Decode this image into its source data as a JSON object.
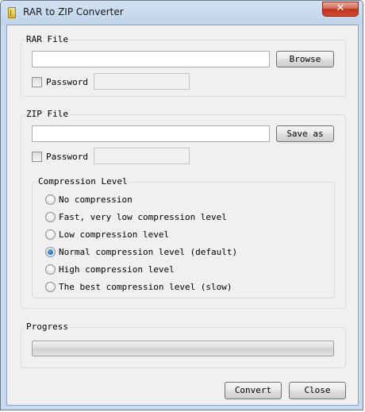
{
  "window": {
    "title": "RAR to ZIP Converter",
    "close_glyph": "✕"
  },
  "rar_group": {
    "label": "RAR File",
    "path_value": "",
    "browse_label": "Browse",
    "password_checked": false,
    "password_label": "Password",
    "password_value": ""
  },
  "zip_group": {
    "label": "ZIP File",
    "path_value": "",
    "save_as_label": "Save as",
    "password_checked": false,
    "password_label": "Password",
    "password_value": ""
  },
  "compression": {
    "label": "Compression Level",
    "options": [
      {
        "label": "No compression",
        "selected": false
      },
      {
        "label": "Fast, very low compression level",
        "selected": false
      },
      {
        "label": "Low compression level",
        "selected": false
      },
      {
        "label": "Normal compression level (default)",
        "selected": true
      },
      {
        "label": "High compression level",
        "selected": false
      },
      {
        "label": "The best compression level (slow)",
        "selected": false
      }
    ]
  },
  "progress": {
    "label": "Progress",
    "value": 0
  },
  "footer": {
    "convert_label": "Convert",
    "close_label": "Close"
  }
}
